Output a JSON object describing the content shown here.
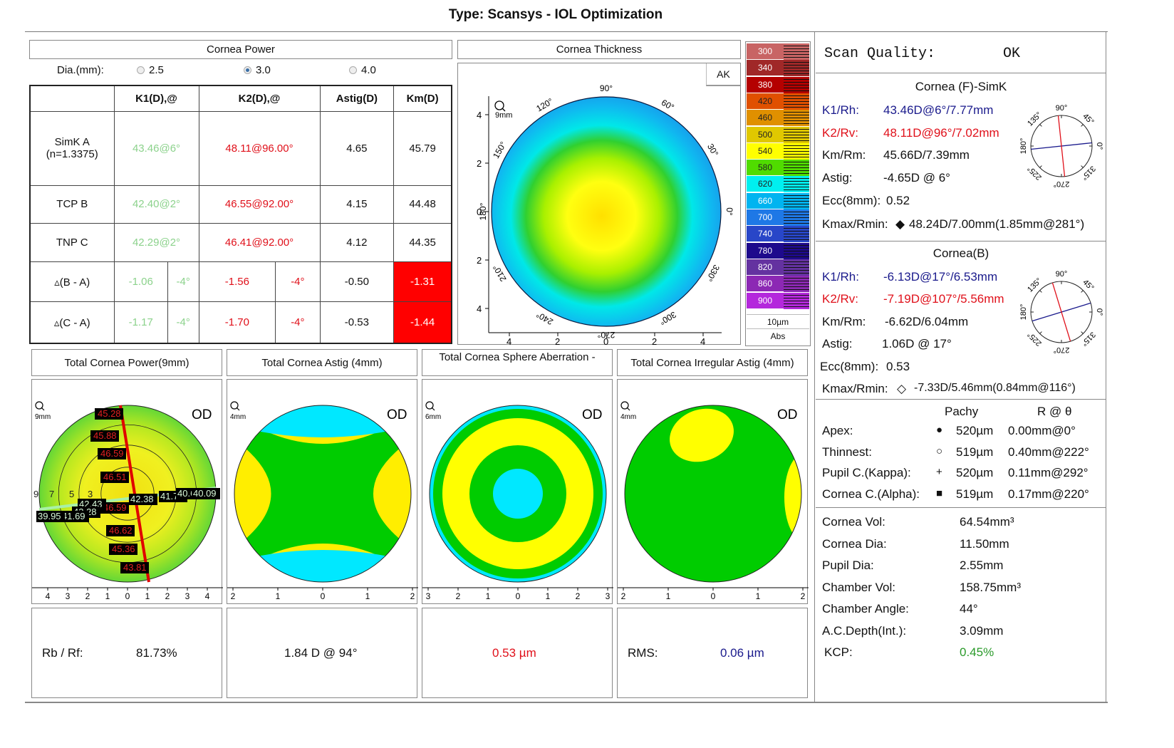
{
  "title": "Type: Scansys - IOL Optimization",
  "cornea_power": {
    "header": "Cornea Power",
    "dia_label": "Dia.(mm):",
    "dia_options": [
      {
        "label": "2.5",
        "selected": false
      },
      {
        "label": "3.0",
        "selected": true
      },
      {
        "label": "4.0",
        "selected": false
      }
    ],
    "columns": [
      "",
      "K1(D),@",
      "K2(D),@",
      "Astig(D)",
      "Km(D)"
    ],
    "rows": [
      {
        "label": "SimK A",
        "sublabel": "(n=1.3375)",
        "k1": "43.46@6°",
        "k2": "48.11@96.00°",
        "astig": "4.65",
        "km": "45.79"
      },
      {
        "label": "TCP B",
        "k1": "42.40@2°",
        "k2": "46.55@92.00°",
        "astig": "4.15",
        "km": "44.48"
      },
      {
        "label": "TNP C",
        "k1": "42.29@2°",
        "k2": "46.41@92.00°",
        "astig": "4.12",
        "km": "44.35"
      }
    ],
    "delta_rows": [
      {
        "label": "▵(B - A)",
        "k1": "-1.06",
        "k1_axis": "-4°",
        "k2": "-1.56",
        "k2_axis": "-4°",
        "astig": "-0.50",
        "km": "-1.31"
      },
      {
        "label": "▵(C - A)",
        "k1": "-1.17",
        "k1_axis": "-4°",
        "k2": "-1.70",
        "k2_axis": "-4°",
        "astig": "-0.53",
        "km": "-1.44"
      }
    ]
  },
  "cornea_thickness": {
    "header": "Cornea Thickness",
    "ak_button": "AK",
    "zoom_label": "9mm",
    "angle_labels": [
      "90°",
      "60°",
      "30°",
      "0°",
      "330°",
      "300°",
      "270°",
      "240°",
      "210°",
      "180°",
      "150°",
      "120°"
    ],
    "y_ticks": [
      "4",
      "2",
      "0",
      "2",
      "4"
    ],
    "x_ticks": [
      "4",
      "2",
      "0",
      "2",
      "4"
    ],
    "scale": [
      {
        "value": "300",
        "color": "#c86464"
      },
      {
        "value": "340",
        "color": "#a02828"
      },
      {
        "value": "380",
        "color": "#b40000"
      },
      {
        "value": "420",
        "color": "#e05000"
      },
      {
        "value": "460",
        "color": "#e09000"
      },
      {
        "value": "500",
        "color": "#e0c800"
      },
      {
        "value": "540",
        "color": "#ffff00"
      },
      {
        "value": "580",
        "color": "#50dc00"
      },
      {
        "value": "620",
        "color": "#00f0f0"
      },
      {
        "value": "660",
        "color": "#00b4f0"
      },
      {
        "value": "700",
        "color": "#1e78e6"
      },
      {
        "value": "740",
        "color": "#2846c8"
      },
      {
        "value": "780",
        "color": "#1e0a8c"
      },
      {
        "value": "820",
        "color": "#6432a0"
      },
      {
        "value": "860",
        "color": "#8c28b4"
      },
      {
        "value": "900",
        "color": "#b428dc"
      }
    ],
    "step_label": "10µm",
    "mode_label": "Abs"
  },
  "scan_quality": {
    "label": "Scan Quality:",
    "value": "OK"
  },
  "cornea_f": {
    "header": "Cornea (F)-SimK",
    "k1_label": "K1/Rh:",
    "k1_value": "43.46D@6°/7.77mm",
    "k2_label": "K2/Rv:",
    "k2_value": "48.11D@96°/7.02mm",
    "km_label": "Km/Rm:",
    "km_value": "45.66D/7.39mm",
    "astig_label": "Astig:",
    "astig_value": "-4.65D @ 6°",
    "ecc_label": "Ecc(8mm):",
    "ecc_value": "0.52",
    "kmax_label": "Kmax/Rmin:",
    "kmax_value": "48.24D/7.00mm(1.85mm@281°)",
    "dial_labels": [
      "90°",
      "45°",
      "0°",
      "315°",
      "270°",
      "225°",
      "180°",
      "135°"
    ]
  },
  "cornea_b": {
    "header": "Cornea(B)",
    "k1_label": "K1/Rh:",
    "k1_value": "-6.13D@17°/6.53mm",
    "k2_label": "K2/Rv:",
    "k2_value": "-7.19D@107°/5.56mm",
    "km_label": "Km/Rm:",
    "km_value": "-6.62D/6.04mm",
    "astig_label": "Astig:",
    "astig_value": "1.06D @ 17°",
    "ecc_label": "Ecc(8mm):",
    "ecc_value": "0.53",
    "kmax_label": "Kmax/Rmin:",
    "kmax_value": "-7.33D/5.46mm(0.84mm@116°)",
    "dial_labels": [
      "90°",
      "45°",
      "0°",
      "315°",
      "270°",
      "225°",
      "180°",
      "135°"
    ]
  },
  "pachy": {
    "col_pachy": "Pachy",
    "col_r": "R @ θ",
    "rows": [
      {
        "label": "Apex:",
        "marker": "●",
        "pachy": "520µm",
        "r": "0.00mm@0°"
      },
      {
        "label": "Thinnest:",
        "marker": "○",
        "pachy": "519µm",
        "r": "0.40mm@222°"
      },
      {
        "label": "Pupil C.(Kappa):",
        "marker": "+",
        "pachy": "520µm",
        "r": "0.11mm@292°"
      },
      {
        "label": "Cornea C.(Alpha):",
        "marker": "■",
        "pachy": "519µm",
        "r": "0.17mm@220°"
      }
    ]
  },
  "metrics": [
    {
      "label": "Cornea Vol:",
      "value": "64.54mm³"
    },
    {
      "label": "Cornea Dia:",
      "value": "11.50mm"
    },
    {
      "label": "Pupil Dia:",
      "value": "2.55mm"
    },
    {
      "label": "Chamber Vol:",
      "value": "158.75mm³"
    },
    {
      "label": "Chamber Angle:",
      "value": "44°"
    },
    {
      "label": "A.C.Depth(Int.):",
      "value": "3.09mm"
    },
    {
      "label": "KCP:",
      "value": "0.45%"
    }
  ],
  "maps": [
    {
      "header": "Total Cornea Power(9mm)",
      "zoom_label": "9mm",
      "eye": "OD",
      "x_ticks": [
        "4",
        "3",
        "2",
        "1",
        "0",
        "1",
        "2",
        "3",
        "4"
      ],
      "ring_labels": [
        "9",
        "7",
        "5",
        "3"
      ],
      "steep_values": [
        "45.28",
        "45.88",
        "46.59",
        "46.51",
        "46.59",
        "46.62",
        "45.36",
        "43.81"
      ],
      "flat_values": [
        "42.43",
        "42.38",
        "41.75",
        "40.6",
        "40.09",
        "42.28",
        "41.69",
        "39.95"
      ],
      "bottom_label": "Rb / Rf:",
      "bottom_value": "81.73%"
    },
    {
      "header": "Total Cornea Astig (4mm)",
      "zoom_label": "4mm",
      "eye": "OD",
      "x_ticks": [
        "2",
        "1",
        "0",
        "1",
        "2"
      ],
      "bottom_value": "1.84 D @ 94°"
    },
    {
      "header": "Total Cornea Sphere Aberration -",
      "zoom_label": "6mm",
      "eye": "OD",
      "x_ticks": [
        "3",
        "2",
        "1",
        "0",
        "1",
        "2",
        "3"
      ],
      "bottom_value": "0.53 µm"
    },
    {
      "header": "Total Cornea Irregular Astig (4mm)",
      "zoom_label": "4mm",
      "eye": "OD",
      "x_ticks": [
        "2",
        "1",
        "0",
        "1",
        "2"
      ],
      "bottom_label": "RMS:",
      "bottom_value": "0.06 µm"
    }
  ],
  "colors": {
    "k1_blue": "#1a1a8c",
    "k2_red": "#e0101a",
    "delta_highlight": "#ff0000",
    "kcp_green": "#2a9a2a"
  }
}
